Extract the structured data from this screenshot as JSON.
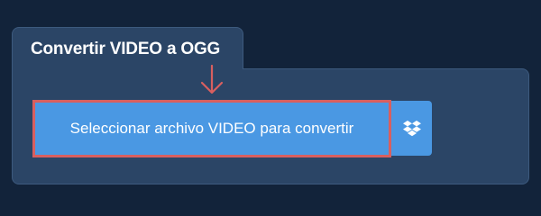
{
  "panel": {
    "title": "Convertir VIDEO a OGG"
  },
  "uploader": {
    "select_label": "Seleccionar archivo VIDEO para convertir",
    "dropbox_icon": "dropbox-icon",
    "pointer_icon": "arrow-down-icon"
  },
  "colors": {
    "page_background": "#12233a",
    "panel_background": "#2b4566",
    "button_background": "#4a98e3",
    "highlight_border": "#d85f5f"
  }
}
